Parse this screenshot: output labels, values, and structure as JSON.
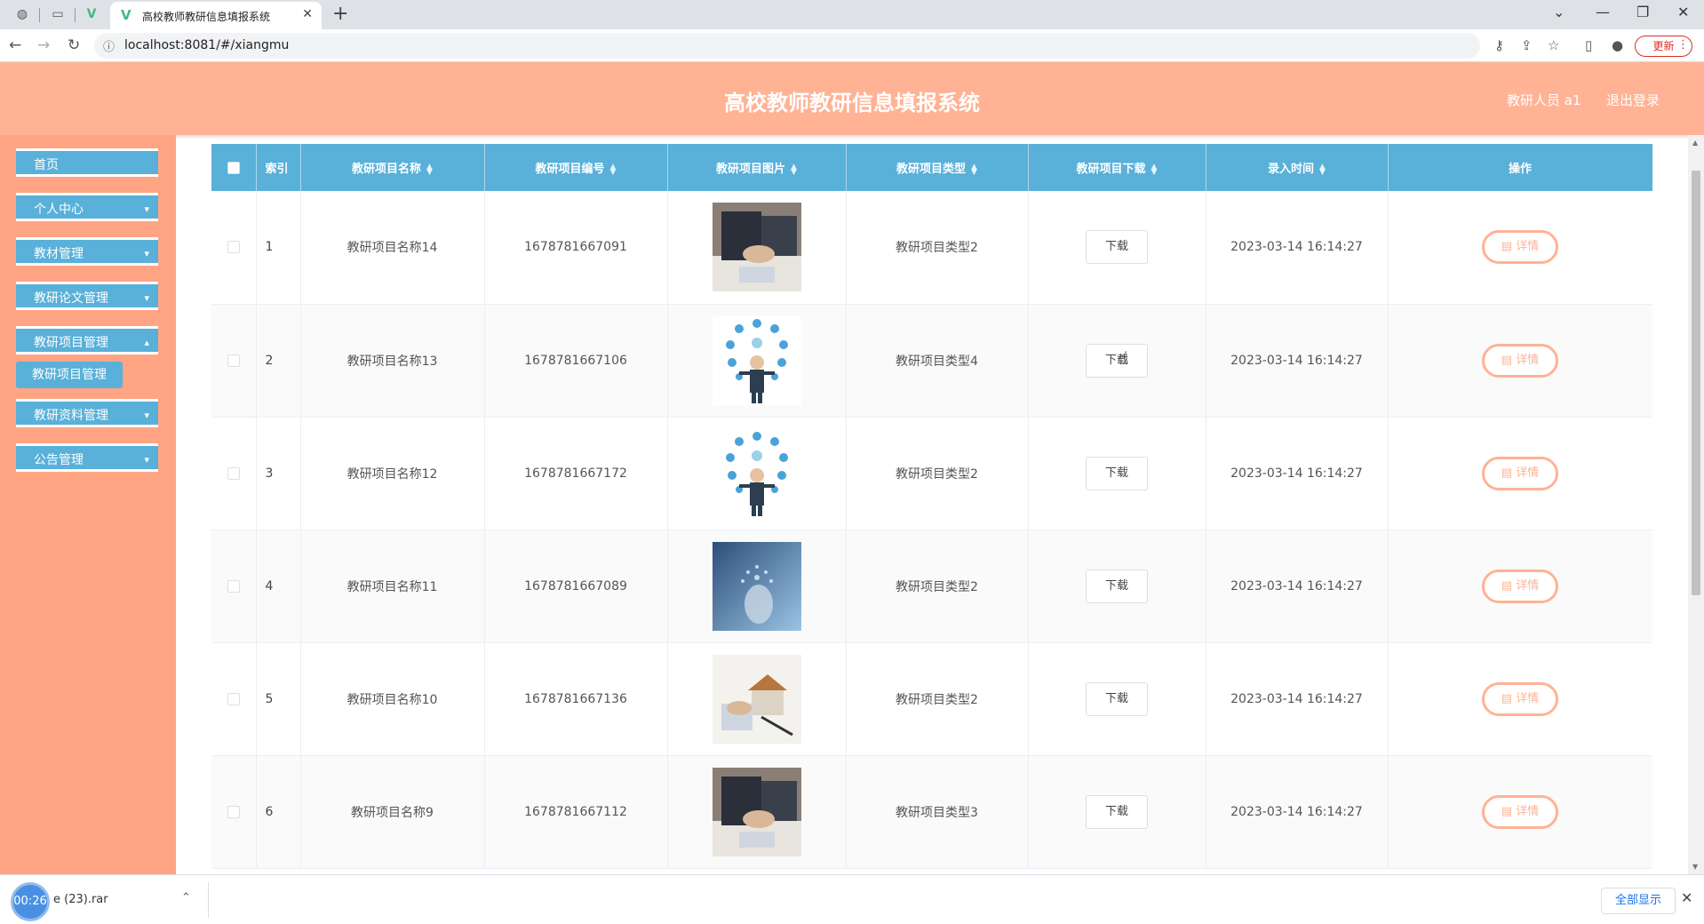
{
  "browser": {
    "tab_title": "高校教师教研信息填报系统",
    "url": "localhost:8081/#/xiangmu",
    "update_label": "更新"
  },
  "header": {
    "title": "高校教师教研信息填报系统",
    "user": "教研人员 a1",
    "logout": "退出登录"
  },
  "sidebar": {
    "items": [
      {
        "label": "首页"
      },
      {
        "label": "个人中心"
      },
      {
        "label": "教材管理"
      },
      {
        "label": "教研论文管理"
      },
      {
        "label": "教研项目管理"
      },
      {
        "label": "教研资料管理"
      },
      {
        "label": "公告管理"
      }
    ],
    "active_sub": "教研项目管理"
  },
  "table": {
    "headers": {
      "index": "索引",
      "name": "教研项目名称",
      "code": "教研项目编号",
      "image": "教研项目图片",
      "type": "教研项目类型",
      "download": "教研项目下载",
      "time": "录入时间",
      "ops": "操作"
    },
    "download_label": "下载",
    "detail_label": "详情",
    "rows": [
      {
        "index": "1",
        "name": "教研项目名称14",
        "code": "1678781667091",
        "type": "教研项目类型2",
        "time": "2023-03-14 16:14:27",
        "image": "business-handshake-photo"
      },
      {
        "index": "2",
        "name": "教研项目名称13",
        "code": "1678781667106",
        "type": "教研项目类型4",
        "time": "2023-03-14 16:14:27",
        "image": "businessman-icons-illustration"
      },
      {
        "index": "3",
        "name": "教研项目名称12",
        "code": "1678781667172",
        "type": "教研项目类型2",
        "time": "2023-03-14 16:14:27",
        "image": "businessman-icons-illustration"
      },
      {
        "index": "4",
        "name": "教研项目名称11",
        "code": "1678781667089",
        "type": "教研项目类型2",
        "time": "2023-03-14 16:14:27",
        "image": "digital-hand-photo"
      },
      {
        "index": "5",
        "name": "教研项目名称10",
        "code": "1678781667136",
        "type": "教研项目类型2",
        "time": "2023-03-14 16:14:27",
        "image": "house-model-photo"
      },
      {
        "index": "6",
        "name": "教研项目名称9",
        "code": "1678781667112",
        "type": "教研项目类型3",
        "time": "2023-03-14 16:14:27",
        "image": "business-handshake-photo"
      }
    ]
  },
  "download_bar": {
    "timer": "00:26",
    "file_name": "e (23).rar",
    "show_all": "全部显示"
  },
  "colors": {
    "header_bg": "#ffb294",
    "sidebar_bg": "#ffa584",
    "menu_bg": "#59b0d8",
    "table_header_bg": "#59b0d8",
    "detail_btn": "#ffb294"
  }
}
